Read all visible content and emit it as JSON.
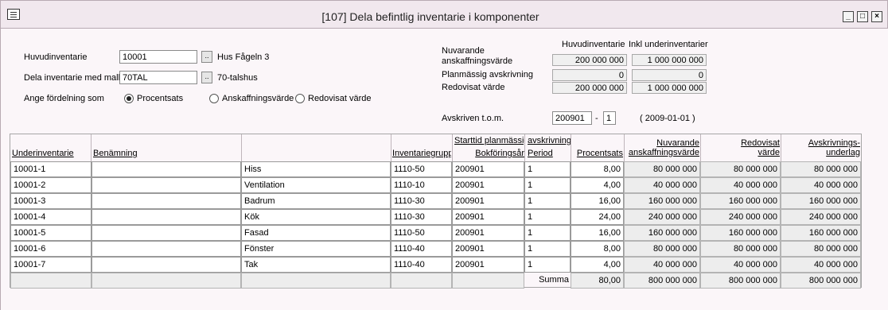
{
  "window": {
    "title": "[107]  Dela befintlig inventarie i komponenter"
  },
  "form": {
    "huvudinventarie_label": "Huvudinventarie",
    "huvudinventarie_value": "10001",
    "huvudinventarie_name": "Hus Fågeln 3",
    "mall_label": "Dela inventarie med mall",
    "mall_value": "70TAL",
    "mall_name": "70-talshus",
    "fordelning_label": "Ange fördelning som",
    "radio_procentsats": "Procentsats",
    "radio_anskaffningsvarde": "Anskaffningsvärde",
    "radio_redovisat": "Redovisat värde",
    "selected_option": "Procentsats"
  },
  "summary": {
    "col_huvud": "Huvudinventarie",
    "col_inkl": "Inkl underinventarier",
    "rows": [
      {
        "label": "Nuvarande\nanskaffningsvärde",
        "huvud": "200 000 000",
        "inkl": "1 000 000 000"
      },
      {
        "label": "Planmässig avskrivning",
        "huvud": "0",
        "inkl": "0"
      },
      {
        "label": "Redovisat värde",
        "huvud": "200 000 000",
        "inkl": "1 000 000 000"
      }
    ],
    "avskriven_label": "Avskriven t.o.m.",
    "avskriven_period": "200901",
    "avskriven_dash": "-",
    "avskriven_sub": "1",
    "avskriven_date": "( 2009-01-01  )"
  },
  "table": {
    "headers": {
      "underinventarie": "Underinventarie",
      "benamning": "Benämning",
      "inventariegrupp": "Inventariegrupp",
      "starttid": "Starttid planmässig",
      "avskrivning": "avskrivning",
      "bokforingsar": "Bokföringsår",
      "period": "Period",
      "procentsats": "Procentsats",
      "nuvarande": "Nuvarande",
      "anskaffningsvarde": "anskaffningsvärde",
      "redovisat": "Redovisat",
      "varde": "värde",
      "avskrivnings": "Avskrivnings-",
      "underlag": "underlag"
    },
    "rows": [
      {
        "id": "10001-1",
        "ben": "",
        "desc": "Hiss",
        "grupp": "1110-50",
        "ar": "200901",
        "period": "1",
        "pct": "8,00",
        "nuv": "80 000 000",
        "red": "80 000 000",
        "und": "80 000 000"
      },
      {
        "id": "10001-2",
        "ben": "",
        "desc": "Ventilation",
        "grupp": "1110-10",
        "ar": "200901",
        "period": "1",
        "pct": "4,00",
        "nuv": "40 000 000",
        "red": "40 000 000",
        "und": "40 000 000"
      },
      {
        "id": "10001-3",
        "ben": "",
        "desc": "Badrum",
        "grupp": "1110-30",
        "ar": "200901",
        "period": "1",
        "pct": "16,00",
        "nuv": "160 000 000",
        "red": "160 000 000",
        "und": "160 000 000"
      },
      {
        "id": "10001-4",
        "ben": "",
        "desc": "Kök",
        "grupp": "1110-30",
        "ar": "200901",
        "period": "1",
        "pct": "24,00",
        "nuv": "240 000 000",
        "red": "240 000 000",
        "und": "240 000 000"
      },
      {
        "id": "10001-5",
        "ben": "",
        "desc": "Fasad",
        "grupp": "1110-50",
        "ar": "200901",
        "period": "1",
        "pct": "16,00",
        "nuv": "160 000 000",
        "red": "160 000 000",
        "und": "160 000 000"
      },
      {
        "id": "10001-6",
        "ben": "",
        "desc": "Fönster",
        "grupp": "1110-40",
        "ar": "200901",
        "period": "1",
        "pct": "8,00",
        "nuv": "80 000 000",
        "red": "80 000 000",
        "und": "80 000 000"
      },
      {
        "id": "10001-7",
        "ben": "",
        "desc": "Tak",
        "grupp": "1110-40",
        "ar": "200901",
        "period": "1",
        "pct": "4,00",
        "nuv": "40 000 000",
        "red": "40 000 000",
        "und": "40 000 000"
      }
    ],
    "summa_label": "Summa",
    "summa": {
      "pct": "80,00",
      "nuv": "800 000 000",
      "red": "800 000 000",
      "und": "800 000 000"
    }
  }
}
